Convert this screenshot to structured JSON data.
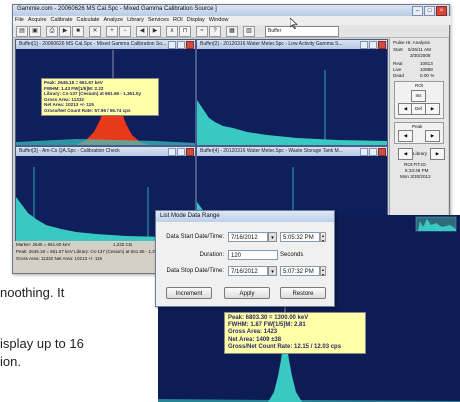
{
  "main_window": {
    "title": "Gammie.com - 20060626 MS Cal.Spc - Mixed Gamma Calibration Source ]",
    "menu": [
      "File",
      "Acquire",
      "Calibrate",
      "Calculate",
      "Analyze",
      "Library",
      "Services",
      "ROI",
      "Display",
      "Window"
    ],
    "combo_value": "Buffer",
    "panes": [
      {
        "title": "Buffer[1] - 20060626 MS Cal.Spc - Mixed Gamma Calibration So..."
      },
      {
        "title": "Buffer[2] - 20120316 Water Meter.Spc - Low Activity Gamma S..."
      },
      {
        "title": "Buffer[3] - Am-Cs QA.Spc - Calibration Check"
      },
      {
        "title": "Buffer[4] - 20120316 Water Meter.Spc - Waste Storage Tank M..."
      }
    ],
    "info_small": {
      "lines": [
        "Peak: 2645.18 = 661.67 keV",
        "FWHM: 1.43  FW[1/5]M: 2.22",
        "Library: Cs-137 (Cesium) at 661.66 - 1,361.0y",
        "Gross Area: 11332",
        "Net Area: 10213 +/- 115",
        "Gross/Net Count Rate: 57.96 / 56.74 cps"
      ]
    },
    "side_panel": {
      "header": "Pulse Ht. Analysis",
      "start_label": "Start",
      "start_value": "5/26/11 AM",
      "start_date": "3/30/2008",
      "real_label": "Real",
      "real_value": "10813",
      "live_label": "Live",
      "live_value": "10898",
      "dead_label": "Dead",
      "dead_value": "0.00 %",
      "roi_label": "ROI",
      "ins_label": "Ins",
      "del_label": "Del",
      "peak_label": "Peak",
      "lib_label": "Library",
      "bottom1": "ROI:FIT.ID",
      "bottom2": "5:33:46 PM",
      "bottom3": "Mon 3/30/2012"
    },
    "status": {
      "marker": "Marker: 2645  =  661.60 keV",
      "counts": "1,232  Cts",
      "line2": "Peak: 2645.18 = 661.67 keV  Library: Cs-137 (Cesium) at 661.66 - 1,361.0y",
      "line3": "Gross Area: 11332   Net Area: 10213 +/- 115"
    }
  },
  "doc_text": [
    "noothing. It",
    "isplay up to 16",
    "ion."
  ],
  "dialog": {
    "title": "List Mode Data Range",
    "start_label": "Data Start Date/Time:",
    "start_date": "7/16/2012",
    "start_time": "5:05:32 PM",
    "duration_label": "Duration:",
    "duration_value": "120",
    "duration_unit": "Seconds",
    "stop_label": "Data Stop Date/Time:",
    "stop_date": "7/16/2012",
    "stop_time": "5:07:32 PM",
    "buttons": [
      "Increment",
      "Apply",
      "Restore"
    ]
  },
  "big_info": {
    "lines": [
      "Peak: 6803.30 = 1300.00 keV",
      "FWHM: 1.87  FW[1/5]M: 2.81",
      "Gross Area: 1423",
      "Net Area: 1409 ±38",
      "Gross/Net Count Rate: 12.15 / 12.03 cps"
    ]
  },
  "colors": {
    "spectrum_bg": "#0f1f5c",
    "spectrum_trace": "#39c9c3",
    "peak_fill": "#e8391b",
    "info_box": "#ffffa8"
  }
}
